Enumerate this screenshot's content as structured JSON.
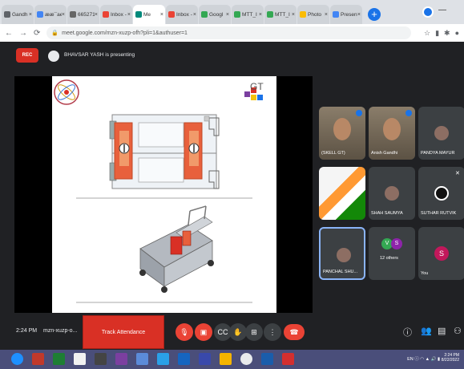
{
  "browser": {
    "tabs": [
      {
        "label": "Gandh",
        "color": "#5f6368"
      },
      {
        "label": "ææ¯ae",
        "color": "#4285f4"
      },
      {
        "label": "665271",
        "color": "#666666"
      },
      {
        "label": "Inbox -",
        "color": "#ea4335"
      },
      {
        "label": "Me",
        "color": "#00897b",
        "active": true
      },
      {
        "label": "Inbox -",
        "color": "#ea4335"
      },
      {
        "label": "Googl",
        "color": "#34a853"
      },
      {
        "label": "MTT_I",
        "color": "#34a853"
      },
      {
        "label": "MTT_I",
        "color": "#34a853"
      },
      {
        "label": "Photo",
        "color": "#fbbc04"
      },
      {
        "label": "Presen",
        "color": "#4285f4"
      }
    ],
    "url": "meet.google.com/mzn-xuzp-ofh?pli=1&authuser=1"
  },
  "meeting": {
    "rec_label": "REC",
    "presenting_text": "BHAVSAR YASH is presenting",
    "clock": "2:24 PM",
    "code": "mzn-xuzp-o...",
    "track_attendance": "Track Attendance"
  },
  "slide": {
    "logo_right": "GT"
  },
  "participants": [
    {
      "name": "(SKELL GT)",
      "type": "video"
    },
    {
      "name": "Anish Gandhi",
      "type": "video"
    },
    {
      "name": "PANDYA MAYUR",
      "type": "avatar"
    },
    {
      "name": "",
      "type": "image"
    },
    {
      "name": "SHAH SAUMYA",
      "type": "avatar"
    },
    {
      "name": "SUTHAR RUTVIK",
      "type": "logo"
    },
    {
      "name": "PANCHAL SHU...",
      "type": "avatar"
    },
    {
      "name": "12 others",
      "type": "others",
      "initials": [
        "V",
        "S"
      ]
    },
    {
      "name": "You",
      "type": "you",
      "initial": "S"
    }
  ],
  "taskbar": {
    "lang": "EN",
    "time": "2:24 PM",
    "date": "8/22/2022"
  },
  "colors": {
    "meet_bg": "#202124",
    "tile_bg": "#3c4043",
    "red": "#d93025",
    "accent": "#1a73e8"
  }
}
